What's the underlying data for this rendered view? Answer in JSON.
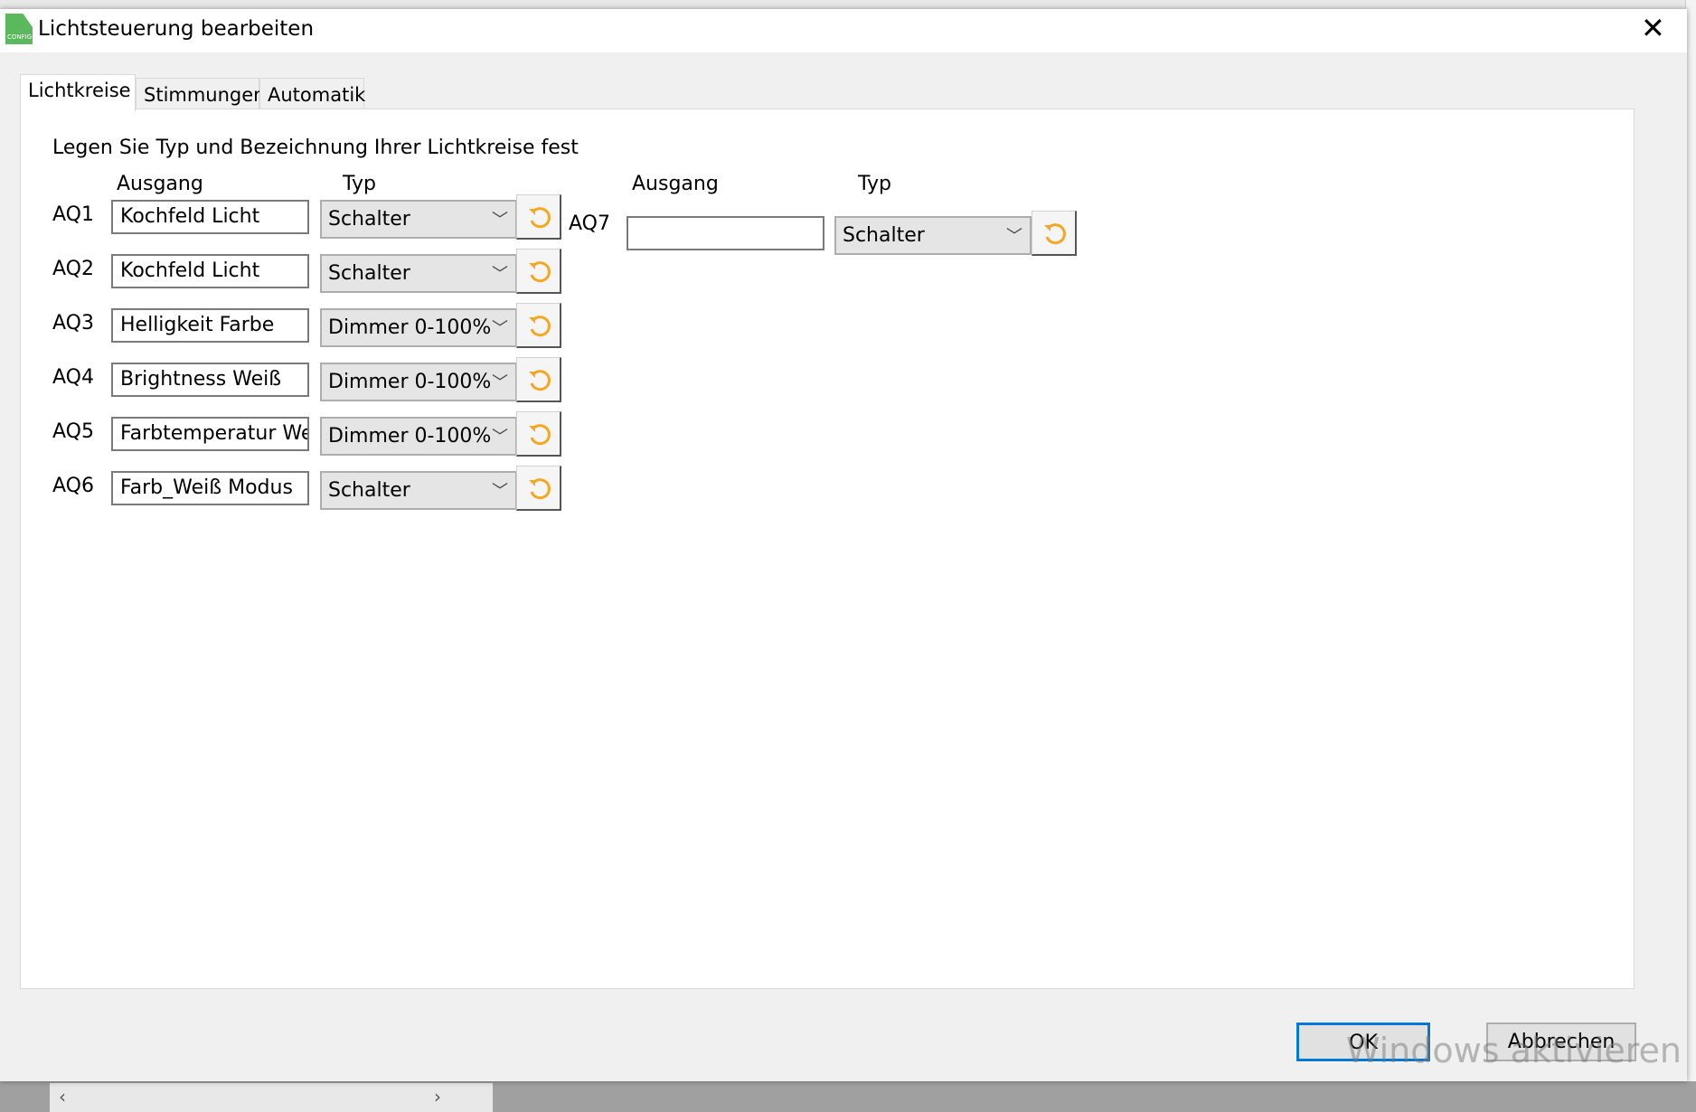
{
  "window": {
    "title": "Lichtsteuerung bearbeiten",
    "icon_label": "CONFIG"
  },
  "tabs": [
    {
      "label": "Lichtkreise",
      "active": true
    },
    {
      "label": "Stimmungen",
      "active": false
    },
    {
      "label": "Automatik",
      "active": false
    }
  ],
  "instruction": "Legen Sie Typ und Bezeichnung Ihrer Lichtkreise fest",
  "headers": {
    "output": "Ausgang",
    "type": "Typ"
  },
  "rows": [
    {
      "id": "AQ1",
      "name": "Kochfeld Licht",
      "type": "Schalter"
    },
    {
      "id": "AQ2",
      "name": "Kochfeld Licht",
      "type": "Schalter"
    },
    {
      "id": "AQ3",
      "name": "Helligkeit Farbe",
      "type": "Dimmer 0-100%"
    },
    {
      "id": "AQ4",
      "name": "Brightness Weiß",
      "type": "Dimmer 0-100%"
    },
    {
      "id": "AQ5",
      "name": "Farbtemperatur Weiß",
      "type": "Dimmer 0-100%"
    },
    {
      "id": "AQ6",
      "name": "Farb_Weiß Modus",
      "type": "Schalter"
    },
    {
      "id": "AQ7",
      "name": "",
      "type": "Schalter"
    }
  ],
  "buttons": {
    "ok": "OK",
    "cancel": "Abbrechen"
  },
  "watermark": "Windows aktivieren",
  "colors": {
    "accent": "#0078d7",
    "reset_icon": "#f5a623"
  }
}
